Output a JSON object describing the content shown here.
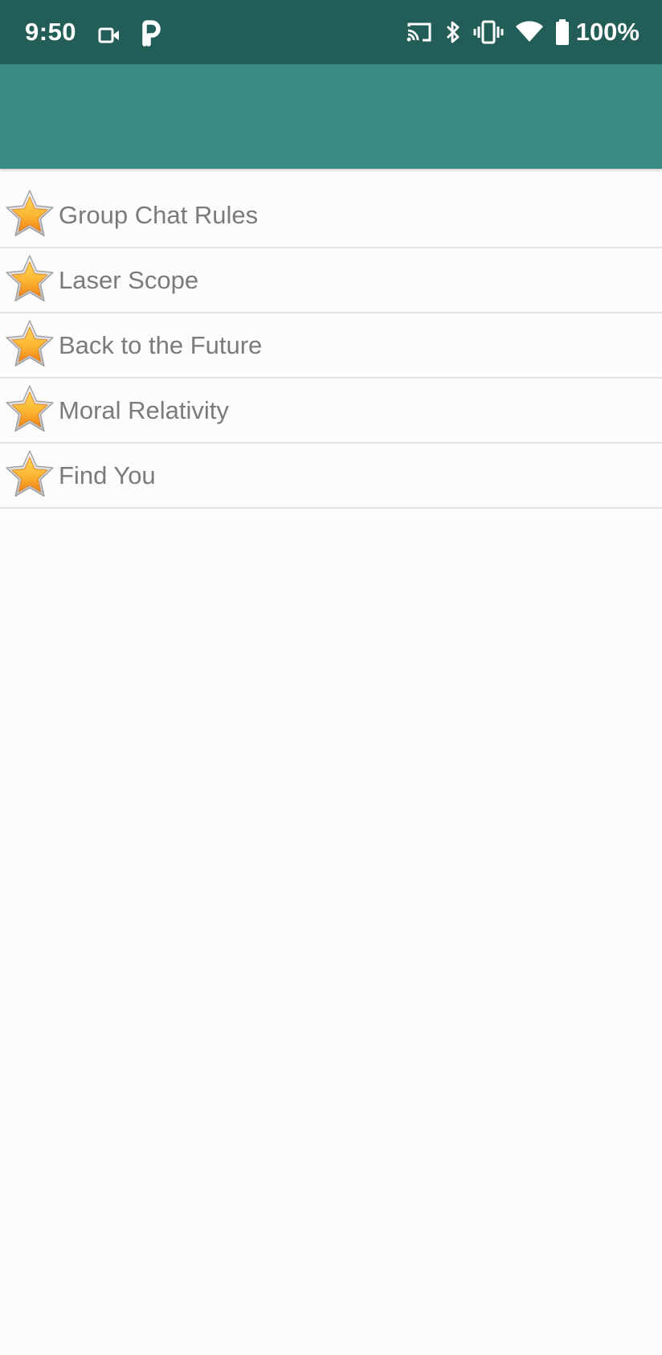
{
  "status_bar": {
    "time": "9:50",
    "left_icons": [
      "video-camera-icon",
      "parking-icon"
    ],
    "right_icons": [
      "cast-icon",
      "bluetooth-icon",
      "vibrate-icon",
      "wifi-icon",
      "battery-icon"
    ],
    "battery": "100%"
  },
  "app_bar": {
    "background": "#378b81"
  },
  "colors": {
    "status_bar": "#235d57",
    "app_bar": "#378b81",
    "text": "#7b7b7b",
    "star": "#f7a823"
  },
  "list": {
    "items": [
      {
        "label": "Group Chat Rules",
        "icon": "star-icon"
      },
      {
        "label": "Laser Scope",
        "icon": "star-icon"
      },
      {
        "label": "Back to the Future",
        "icon": "star-icon"
      },
      {
        "label": "Moral Relativity",
        "icon": "star-icon"
      },
      {
        "label": "Find You",
        "icon": "star-icon"
      }
    ]
  }
}
